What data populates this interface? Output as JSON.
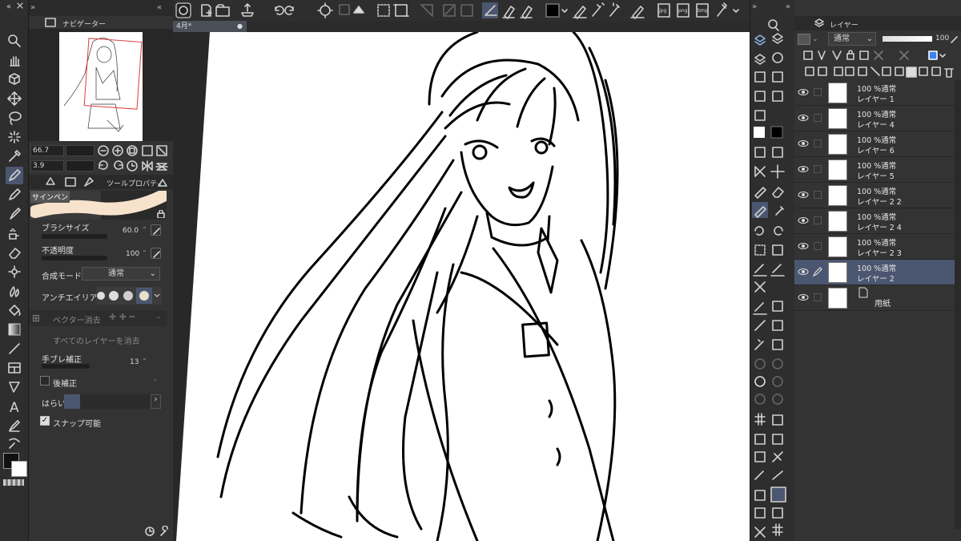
{
  "colors": {
    "panel_bg": "#333333",
    "strip_bg": "#2e2e2e",
    "selected_row": "#4b5670",
    "brush_preview": "#f7e3cc",
    "accent_blue": "#3b82f6"
  },
  "navigator": {
    "tab_label": "ナビゲーター",
    "zoom": "66.7",
    "rotation": "3.9"
  },
  "tool_property": {
    "tab_label": "ツールプロパティ",
    "tool_name": "サインペン",
    "brush_size": {
      "label": "ブラシサイズ",
      "value": "60.0"
    },
    "opacity": {
      "label": "不透明度",
      "value": "100"
    },
    "blend_mode": {
      "label": "合成モード",
      "value": "通常"
    },
    "antialias": {
      "label": "アンチエイリアス"
    },
    "vector_erase": {
      "label": "ベクター消去"
    },
    "erase_all_layers": {
      "label": "すべてのレイヤーを消去"
    },
    "stabilization": {
      "label": "手ブレ補正",
      "value": "13"
    },
    "post_correction": {
      "label": "後補正"
    },
    "taper": {
      "label": "はらい"
    },
    "snap": {
      "label": "スナップ可能"
    }
  },
  "document": {
    "tab_title": "4月*"
  },
  "layer_panel": {
    "tab_label": "レイヤー",
    "blend_mode": "通常",
    "opacity": "100",
    "layers": [
      {
        "percent": "100 %通常",
        "name": "レイヤー 1",
        "selected": false
      },
      {
        "percent": "100 %通常",
        "name": "レイヤー 4",
        "selected": false
      },
      {
        "percent": "100 %通常",
        "name": "レイヤー 6",
        "selected": false
      },
      {
        "percent": "100 %通常",
        "name": "レイヤー 5",
        "selected": false
      },
      {
        "percent": "100 %通常",
        "name": "レイヤー 2 2",
        "selected": false
      },
      {
        "percent": "100 %通常",
        "name": "レイヤー 2 4",
        "selected": false
      },
      {
        "percent": "100 %通常",
        "name": "レイヤー 2 3",
        "selected": false
      },
      {
        "percent": "100 %通常",
        "name": "レイヤー 2",
        "selected": true
      }
    ],
    "paper_layer": {
      "name": "用紙"
    }
  },
  "top_toolbar": {
    "jpg": "jpg",
    "png": "png",
    "bmp": "bmp"
  }
}
